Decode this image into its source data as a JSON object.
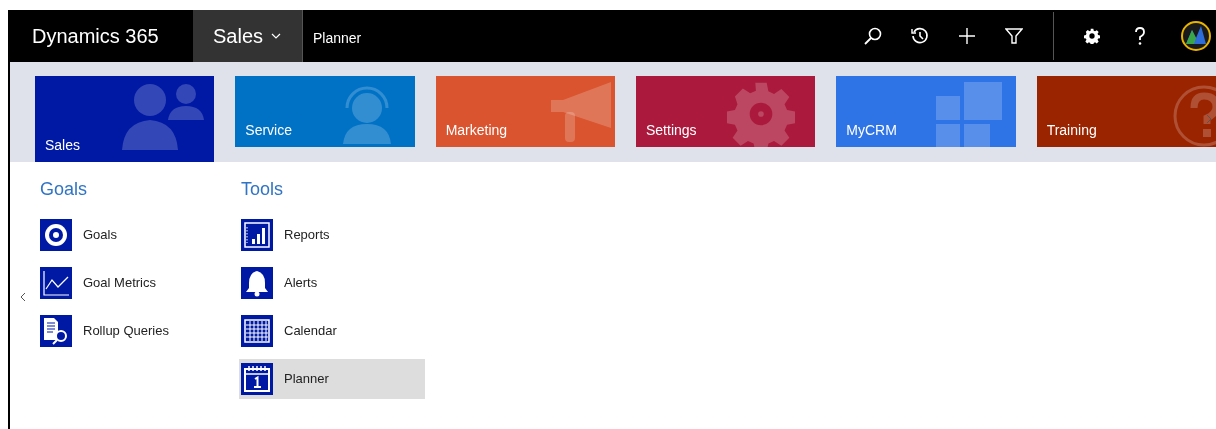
{
  "top_bar": {
    "product": "Dynamics 365",
    "module": "Sales",
    "breadcrumb": "Planner"
  },
  "tiles": [
    {
      "label": "Sales",
      "kind": "people",
      "color": "#0019a5",
      "selected": true
    },
    {
      "label": "Service",
      "kind": "headset",
      "color": "#0072c6",
      "selected": false
    },
    {
      "label": "Marketing",
      "kind": "megaphone",
      "color": "#d9542f",
      "selected": false
    },
    {
      "label": "Settings",
      "kind": "gear",
      "color": "#ab1a3c",
      "selected": false
    },
    {
      "label": "MyCRM",
      "kind": "squares",
      "color": "#2f74e6",
      "selected": false
    },
    {
      "label": "Training",
      "kind": "question",
      "color": "#9b2400",
      "selected": false
    }
  ],
  "groups": [
    {
      "title": "Goals",
      "items": [
        {
          "label": "Goals",
          "kind": "target",
          "selected": false
        },
        {
          "label": "Goal Metrics",
          "kind": "chart",
          "selected": false
        },
        {
          "label": "Rollup Queries",
          "kind": "query",
          "selected": false
        }
      ]
    },
    {
      "title": "Tools",
      "items": [
        {
          "label": "Reports",
          "kind": "report",
          "selected": false
        },
        {
          "label": "Alerts",
          "kind": "bell",
          "selected": false
        },
        {
          "label": "Calendar",
          "kind": "calendar",
          "selected": false
        },
        {
          "label": "Planner",
          "kind": "planner",
          "selected": true
        }
      ]
    }
  ]
}
